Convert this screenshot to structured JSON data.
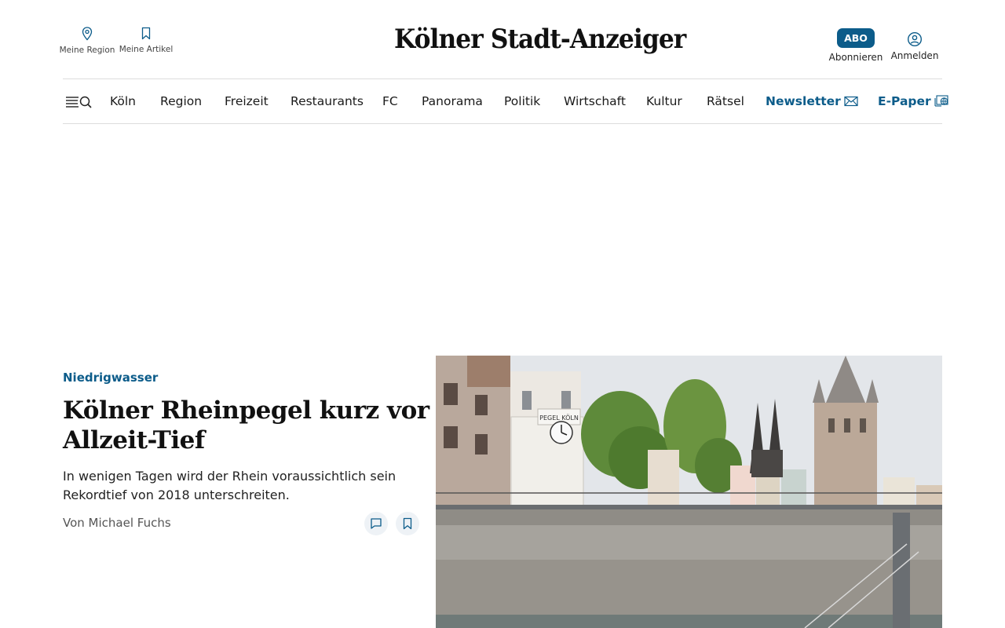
{
  "header": {
    "region_label": "Meine Region",
    "artikel_label": "Meine Artikel",
    "logo_text": "Kölner Stadt-Anzeiger",
    "abo_badge": "ABO",
    "abo_label": "Abonnieren",
    "login_label": "Anmelden"
  },
  "nav": {
    "items": [
      "Köln",
      "Region",
      "Freizeit",
      "Restaurants",
      "FC",
      "Panorama",
      "Politik",
      "Wirtschaft",
      "Kultur",
      "Rätsel"
    ],
    "newsletter": "Newsletter",
    "epaper": "E-Paper"
  },
  "article": {
    "kicker": "Niedrigwasser",
    "headline": "Kölner Rheinpegel kurz vor Allzeit-Tief",
    "teaser": "In wenigen Tagen wird der Rhein voraussichtlich sein Rekordtief von 2018 unterschreiten.",
    "author": "Von Michael Fuchs",
    "image_sign_text": "PEGEL KÖLN"
  },
  "colors": {
    "accent": "#0c5c8a"
  }
}
